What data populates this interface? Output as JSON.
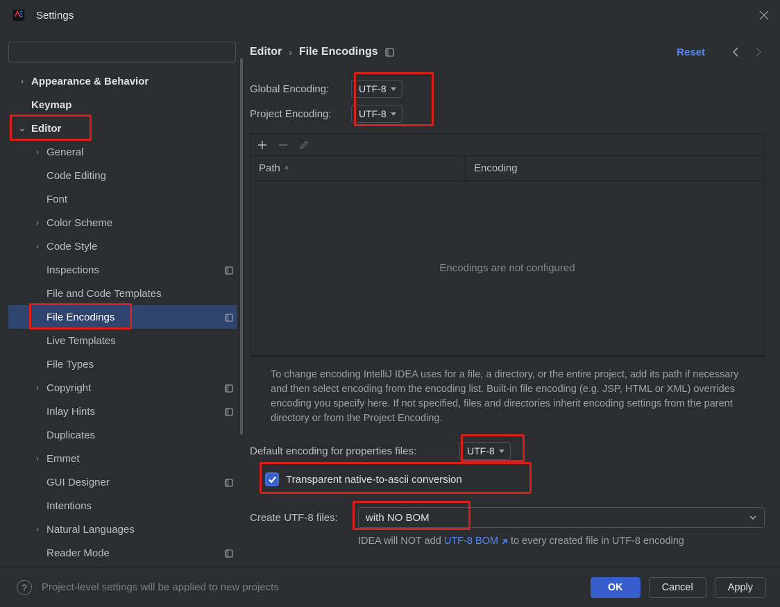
{
  "window": {
    "title": "Settings"
  },
  "search": {
    "placeholder": ""
  },
  "tree": [
    {
      "label": "Appearance & Behavior",
      "level": 0,
      "arrow": "right",
      "bold": true
    },
    {
      "label": "Keymap",
      "level": 0,
      "arrow": "none",
      "bold": true
    },
    {
      "label": "Editor",
      "level": 0,
      "arrow": "down",
      "bold": true,
      "redbox": true
    },
    {
      "label": "General",
      "level": 1,
      "arrow": "right"
    },
    {
      "label": "Code Editing",
      "level": 1,
      "arrow": "none"
    },
    {
      "label": "Font",
      "level": 1,
      "arrow": "none"
    },
    {
      "label": "Color Scheme",
      "level": 1,
      "arrow": "right"
    },
    {
      "label": "Code Style",
      "level": 1,
      "arrow": "right"
    },
    {
      "label": "Inspections",
      "level": 1,
      "arrow": "none",
      "indicator": true
    },
    {
      "label": "File and Code Templates",
      "level": 1,
      "arrow": "none"
    },
    {
      "label": "File Encodings",
      "level": 1,
      "arrow": "none",
      "indicator": true,
      "selected": true,
      "redbox": true
    },
    {
      "label": "Live Templates",
      "level": 1,
      "arrow": "none"
    },
    {
      "label": "File Types",
      "level": 1,
      "arrow": "none"
    },
    {
      "label": "Copyright",
      "level": 1,
      "arrow": "right",
      "indicator": true
    },
    {
      "label": "Inlay Hints",
      "level": 1,
      "arrow": "none",
      "indicator": true
    },
    {
      "label": "Duplicates",
      "level": 1,
      "arrow": "none"
    },
    {
      "label": "Emmet",
      "level": 1,
      "arrow": "right"
    },
    {
      "label": "GUI Designer",
      "level": 1,
      "arrow": "none",
      "indicator": true
    },
    {
      "label": "Intentions",
      "level": 1,
      "arrow": "none"
    },
    {
      "label": "Natural Languages",
      "level": 1,
      "arrow": "right"
    },
    {
      "label": "Reader Mode",
      "level": 1,
      "arrow": "none",
      "indicator": true
    }
  ],
  "breadcrumb": {
    "parent": "Editor",
    "current": "File Encodings",
    "reset": "Reset"
  },
  "encodings": {
    "global_label": "Global Encoding:",
    "global_value": "UTF-8",
    "project_label": "Project Encoding:",
    "project_value": "UTF-8"
  },
  "table": {
    "col_path": "Path",
    "col_enc": "Encoding",
    "empty": "Encodings are not configured"
  },
  "help": "To change encoding IntelliJ IDEA uses for a file, a directory, or the entire project, add its path if necessary and then select encoding from the encoding list. Built-in file encoding (e.g. JSP, HTML or XML) overrides encoding you specify here. If not specified, files and directories inherit encoding settings from the parent directory or from the Project Encoding.",
  "properties": {
    "label": "Default encoding for properties files:",
    "value": "UTF-8",
    "checkbox_label": "Transparent native-to-ascii conversion"
  },
  "bom": {
    "label": "Create UTF-8 files:",
    "value": "with NO BOM",
    "hint_pre": "IDEA will NOT add ",
    "hint_link": "UTF-8 BOM",
    "hint_post": "  to every created file in UTF-8 encoding"
  },
  "bottom": {
    "note": "Project-level settings will be applied to new projects",
    "ok": "OK",
    "cancel": "Cancel",
    "apply": "Apply"
  }
}
